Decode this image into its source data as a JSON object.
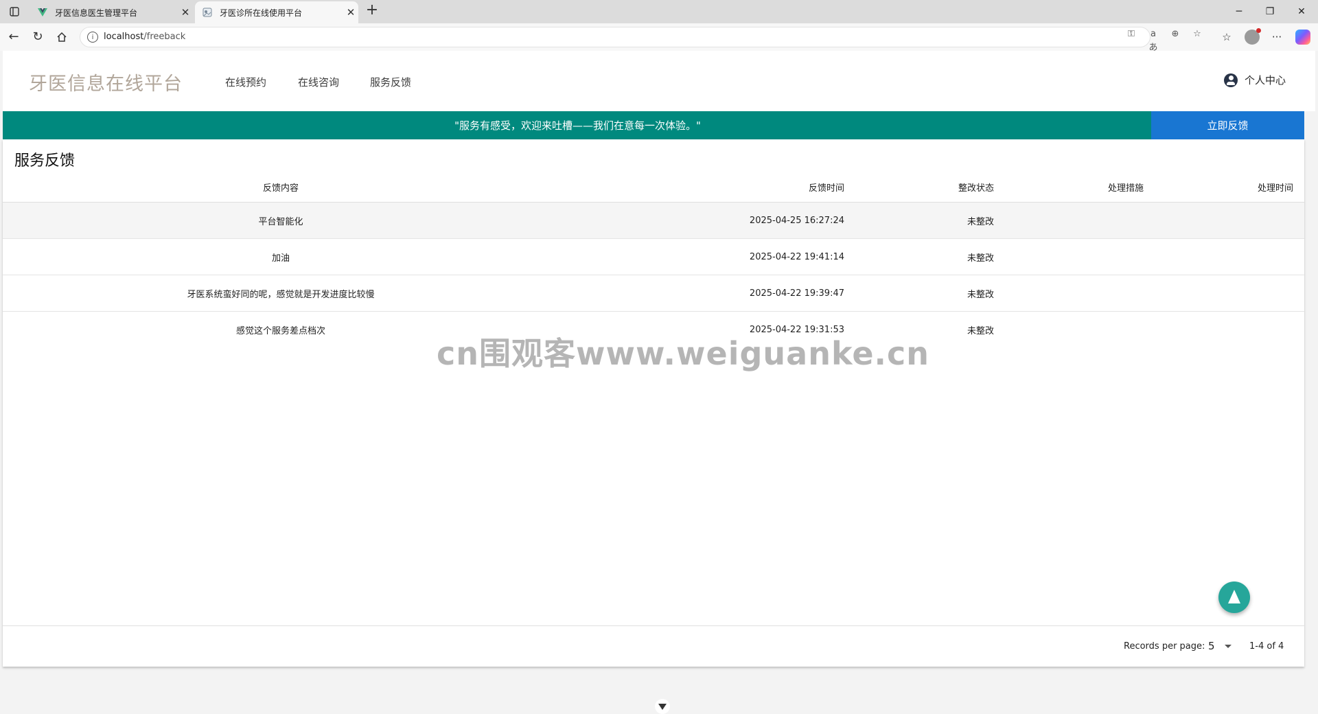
{
  "browser": {
    "tabs": [
      {
        "title": "牙医信息医生管理平台",
        "active": false
      },
      {
        "title": "牙医诊所在线使用平台",
        "active": true
      }
    ],
    "url_host": "localhost",
    "url_path": "/freeback"
  },
  "header": {
    "brand": "牙医信息在线平台",
    "nav": [
      "在线预约",
      "在线咨询",
      "服务反馈"
    ],
    "user_label": "个人中心"
  },
  "banner": {
    "text": "\"服务有感受，欢迎来吐槽——我们在意每一次体验。\"",
    "button_label": "立即反馈"
  },
  "section_title": "服务反馈",
  "table": {
    "headers": [
      "反馈内容",
      "反馈时间",
      "整改状态",
      "处理措施",
      "处理时间"
    ],
    "rows": [
      {
        "content": "平台智能化",
        "time": "2025-04-25 16:27:24",
        "status": "未整改",
        "measure": "",
        "handled_time": ""
      },
      {
        "content": "加油",
        "time": "2025-04-22 19:41:14",
        "status": "未整改",
        "measure": "",
        "handled_time": ""
      },
      {
        "content": "牙医系统蛮好同的呢，感觉就是开发进度比较慢",
        "time": "2025-04-22 19:39:47",
        "status": "未整改",
        "measure": "",
        "handled_time": ""
      },
      {
        "content": "感觉这个服务差点档次",
        "time": "2025-04-22 19:31:53",
        "status": "未整改",
        "measure": "",
        "handled_time": ""
      }
    ]
  },
  "pagination": {
    "rows_per_page_label": "Records per page:",
    "rows_per_page": "5",
    "range": "1-4 of 4"
  },
  "watermark": "cn围观客www.weiguanke.cn",
  "colors": {
    "banner": "#00897e",
    "feedback_button": "#1976d2",
    "fab": "#26a69a",
    "brand_text": "#b1a69a"
  }
}
